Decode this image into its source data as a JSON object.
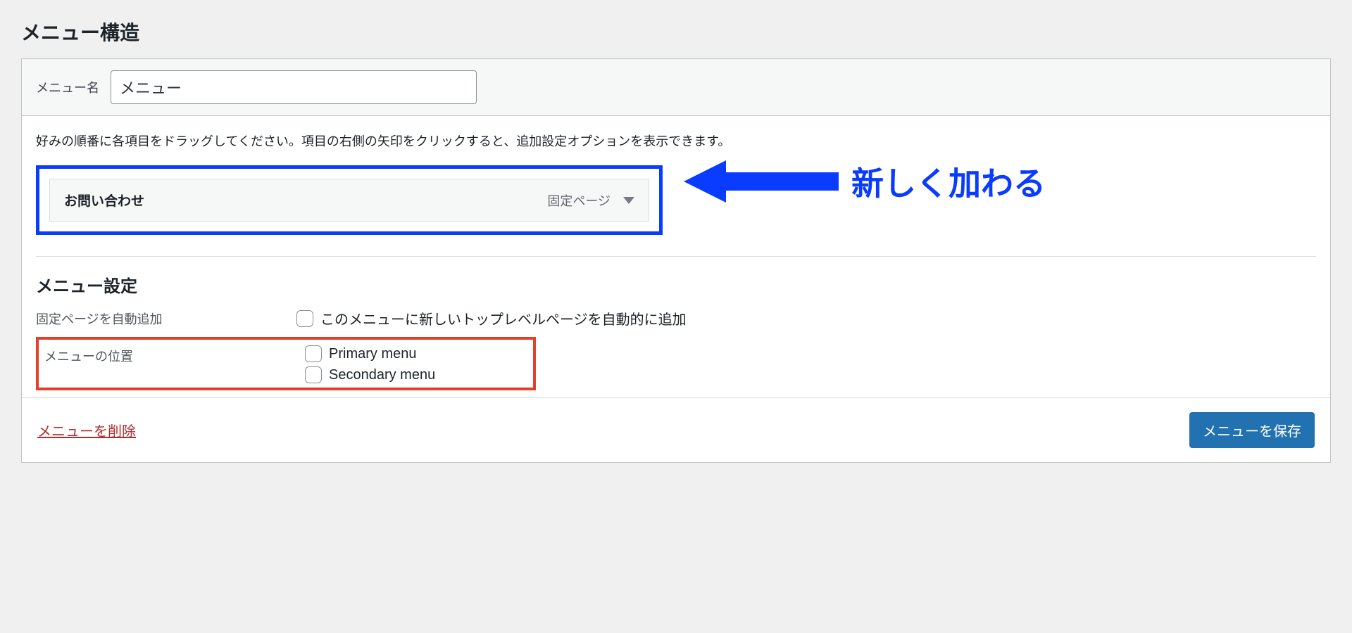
{
  "section_title": "メニュー構造",
  "menu_name_label": "メニュー名",
  "menu_name_value": "メニュー",
  "instructions": "好みの順番に各項目をドラッグしてください。項目の右側の矢印をクリックすると、追加設定オプションを表示できます。",
  "menu_item": {
    "title": "お問い合わせ",
    "type": "固定ページ"
  },
  "annotation": "新しく加わる",
  "settings_title": "メニュー設定",
  "auto_add": {
    "label": "固定ページを自動追加",
    "option": "このメニューに新しいトップレベルページを自動的に追加"
  },
  "location": {
    "label": "メニューの位置",
    "options": [
      "Primary menu",
      "Secondary menu"
    ]
  },
  "delete_menu": "メニューを削除",
  "save_menu": "メニューを保存"
}
